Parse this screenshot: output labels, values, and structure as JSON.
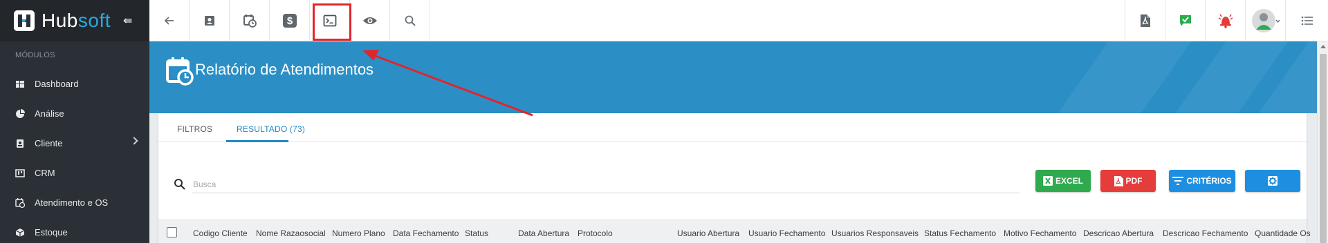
{
  "brand": {
    "name_a": "Hub",
    "name_b": "soft",
    "collapse_glyph": "⇚"
  },
  "sidebar": {
    "section_title": "MÓDULOS",
    "items": [
      {
        "label": "Dashboard",
        "icon": "dashboard-icon"
      },
      {
        "label": "Análise",
        "icon": "pie-chart-icon"
      },
      {
        "label": "Cliente",
        "icon": "contact-card-icon",
        "has_submenu": true
      },
      {
        "label": "CRM",
        "icon": "kanban-icon"
      },
      {
        "label": "Atendimento e OS",
        "icon": "calendar-clock-icon"
      },
      {
        "label": "Estoque",
        "icon": "box-icon"
      }
    ]
  },
  "topbar": {
    "left_buttons": [
      "back-arrow-icon",
      "contact-card-icon",
      "calendar-clock-icon",
      "dollar-icon",
      "terminal-icon",
      "eye-icon",
      "search-icon"
    ],
    "right_buttons": [
      "pdf-file-icon",
      "chat-check-icon",
      "alarm-bell-icon",
      "user-avatar",
      "list-menu-icon"
    ],
    "highlighted": "terminal-icon"
  },
  "page": {
    "title": "Relatório de Atendimentos"
  },
  "tabs": [
    {
      "label": "FILTROS",
      "active": false
    },
    {
      "label": "RESULTADO (73)",
      "active": true
    }
  ],
  "search": {
    "placeholder": "Busca",
    "value": ""
  },
  "actions": {
    "excel": "EXCEL",
    "pdf": "PDF",
    "criteria": "CRITÉRIOS",
    "settings_icon": "gear-icon"
  },
  "table": {
    "columns": [
      "Codigo Cliente",
      "Nome Razaosocial",
      "Numero Plano",
      "Data Fechamento",
      "Status",
      "Data Abertura",
      "Protocolo",
      "Usuario Abertura",
      "Usuario Fechamento",
      "Usuarios Responsaveis",
      "Status Fechamento",
      "Motivo Fechamento",
      "Descricao Abertura",
      "Descricao Fechamento",
      "Quantidade Os"
    ]
  },
  "colors": {
    "sidebar_bg": "#2b3036",
    "banner": "#2b8fc6",
    "accent": "#1e88c8",
    "excel": "#2faa4e",
    "pdf": "#e53c3c",
    "criteria": "#1e8fe0",
    "highlight": "#e3242b",
    "annotation_arrow": "#e3242b"
  }
}
